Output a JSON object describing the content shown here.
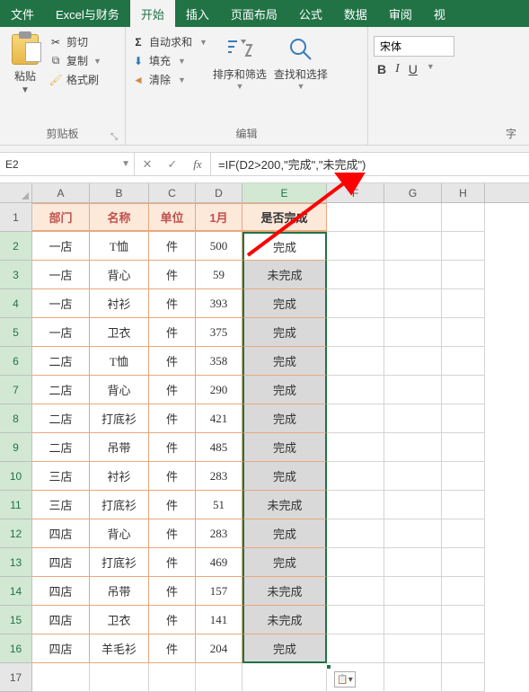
{
  "menus": {
    "file": "文件",
    "custom": "Excel与财务",
    "home": "开始",
    "insert": "插入",
    "layout": "页面布局",
    "formulas": "公式",
    "data": "数据",
    "review": "审阅",
    "view": "视",
    "share": ""
  },
  "ribbon": {
    "clipboard": {
      "paste": "粘贴",
      "cut": "剪切",
      "copy": "复制",
      "brush": "格式刷",
      "group": "剪贴板"
    },
    "edit": {
      "autosum": "自动求和",
      "fill": "填充",
      "clear": "清除",
      "sort": "排序和筛选",
      "find": "查找和选择",
      "group": "编辑"
    },
    "font": {
      "name": "宋体",
      "b": "B",
      "i": "I",
      "u": "U",
      "group": "字"
    }
  },
  "namebox": "E2",
  "formula": "=IF(D2>200,\"完成\",\"未完成\")",
  "columns": [
    "A",
    "B",
    "C",
    "D",
    "E",
    "F",
    "G",
    "H"
  ],
  "headers": {
    "A": "部门",
    "B": "名称",
    "C": "单位",
    "D": "1月",
    "E": "是否完成"
  },
  "rows": [
    {
      "n": 2,
      "A": "一店",
      "B": "T恤",
      "C": "件",
      "D": "500",
      "E": "完成"
    },
    {
      "n": 3,
      "A": "一店",
      "B": "背心",
      "C": "件",
      "D": "59",
      "E": "未完成"
    },
    {
      "n": 4,
      "A": "一店",
      "B": "衬衫",
      "C": "件",
      "D": "393",
      "E": "完成"
    },
    {
      "n": 5,
      "A": "一店",
      "B": "卫衣",
      "C": "件",
      "D": "375",
      "E": "完成"
    },
    {
      "n": 6,
      "A": "二店",
      "B": "T恤",
      "C": "件",
      "D": "358",
      "E": "完成"
    },
    {
      "n": 7,
      "A": "二店",
      "B": "背心",
      "C": "件",
      "D": "290",
      "E": "完成"
    },
    {
      "n": 8,
      "A": "二店",
      "B": "打底衫",
      "C": "件",
      "D": "421",
      "E": "完成"
    },
    {
      "n": 9,
      "A": "二店",
      "B": "吊带",
      "C": "件",
      "D": "485",
      "E": "完成"
    },
    {
      "n": 10,
      "A": "三店",
      "B": "衬衫",
      "C": "件",
      "D": "283",
      "E": "完成"
    },
    {
      "n": 11,
      "A": "三店",
      "B": "打底衫",
      "C": "件",
      "D": "51",
      "E": "未完成"
    },
    {
      "n": 12,
      "A": "四店",
      "B": "背心",
      "C": "件",
      "D": "283",
      "E": "完成"
    },
    {
      "n": 13,
      "A": "四店",
      "B": "打底衫",
      "C": "件",
      "D": "469",
      "E": "完成"
    },
    {
      "n": 14,
      "A": "四店",
      "B": "吊带",
      "C": "件",
      "D": "157",
      "E": "未完成"
    },
    {
      "n": 15,
      "A": "四店",
      "B": "卫衣",
      "C": "件",
      "D": "141",
      "E": "未完成"
    },
    {
      "n": 16,
      "A": "四店",
      "B": "羊毛衫",
      "C": "件",
      "D": "204",
      "E": "完成"
    }
  ],
  "empty_row": 17
}
